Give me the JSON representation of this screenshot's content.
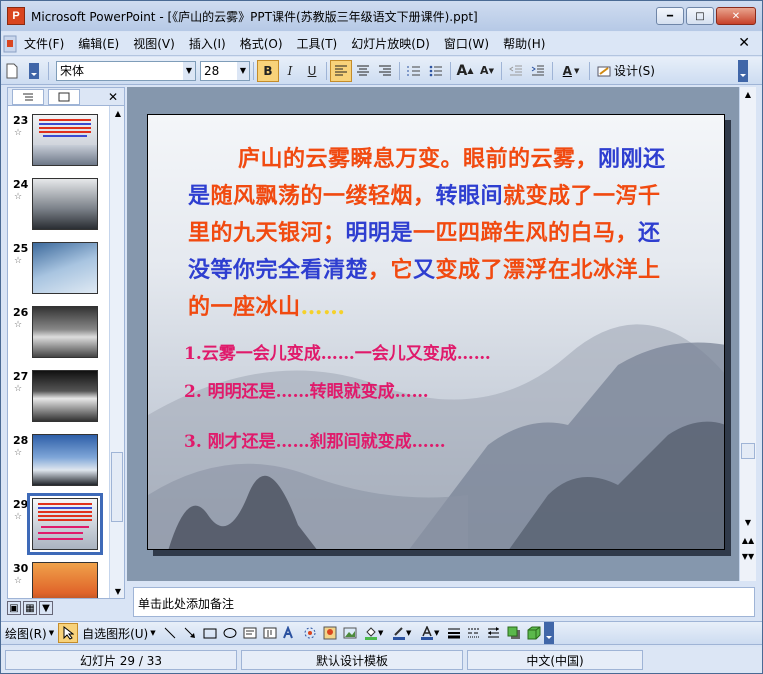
{
  "window": {
    "app_icon": "P",
    "title": "Microsoft PowerPoint - [《庐山的云雾》PPT课件(苏教版三年级语文下册课件).ppt]",
    "btn_min": "━",
    "btn_max": "□",
    "btn_close": "✕"
  },
  "menubar": {
    "items": [
      "文件(F)",
      "编辑(E)",
      "视图(V)",
      "插入(I)",
      "格式(O)",
      "工具(T)",
      "幻灯片放映(D)",
      "窗口(W)",
      "帮助(H)"
    ],
    "close": "✕"
  },
  "toolbar": {
    "font_name": "宋体",
    "font_size": "28",
    "bold": "B",
    "italic": "I",
    "underline": "U",
    "grow_font": "A",
    "shrink_font": "A",
    "font_color": "A",
    "design_label": "设计(S)"
  },
  "left_pane": {
    "thumbnails": [
      {
        "num": "23",
        "star": "☆",
        "kind": "text"
      },
      {
        "num": "24",
        "star": "☆",
        "kind": "mountain"
      },
      {
        "num": "25",
        "star": "☆",
        "kind": "sky"
      },
      {
        "num": "26",
        "star": "☆",
        "kind": "mist"
      },
      {
        "num": "27",
        "star": "☆",
        "kind": "sea"
      },
      {
        "num": "28",
        "star": "☆",
        "kind": "peak"
      },
      {
        "num": "29",
        "star": "☆",
        "kind": "text-selected"
      },
      {
        "num": "30",
        "star": "☆",
        "kind": "sunset"
      }
    ],
    "close": "✕"
  },
  "slide": {
    "paragraph_segments": [
      {
        "text": "庐山的云雾瞬息万变。眼前的云雾，",
        "color": "red"
      },
      {
        "text": "刚刚还是",
        "color": "blue"
      },
      {
        "text": "随风飘荡的一缕轻烟，",
        "color": "red"
      },
      {
        "text": "转眼间",
        "color": "blue"
      },
      {
        "text": "就变成了一泻千里的九天银河；",
        "color": "red"
      },
      {
        "text": "明明是",
        "color": "blue"
      },
      {
        "text": "一匹四蹄生风的白马，",
        "color": "red"
      },
      {
        "text": "还没等你完全看清楚",
        "color": "blue"
      },
      {
        "text": "，它",
        "color": "red"
      },
      {
        "text": "又",
        "color": "blue"
      },
      {
        "text": "变成了漂浮在北冰洋上的一座冰山",
        "color": "red"
      },
      {
        "text": "……",
        "color": "yellow"
      }
    ],
    "items": [
      "1.云雾一会儿变成……一会儿又变成……",
      "2. 明明还是……转眼就变成……",
      "3. 刚才还是……刹那间就变成……"
    ]
  },
  "notes": {
    "placeholder": "单击此处添加备注"
  },
  "draw_toolbar": {
    "draw_label": "绘图(R)",
    "autoshape_label": "自选图形(U)"
  },
  "status": {
    "slide_info": "幻灯片 29 / 33",
    "template": "默认设计模板",
    "language": "中文(中国)"
  },
  "colors": {
    "para_red": "#f14a10",
    "para_blue": "#2e3ed0",
    "item_pink": "#e01a6b",
    "ellipsis_yellow": "#f5d12a"
  }
}
